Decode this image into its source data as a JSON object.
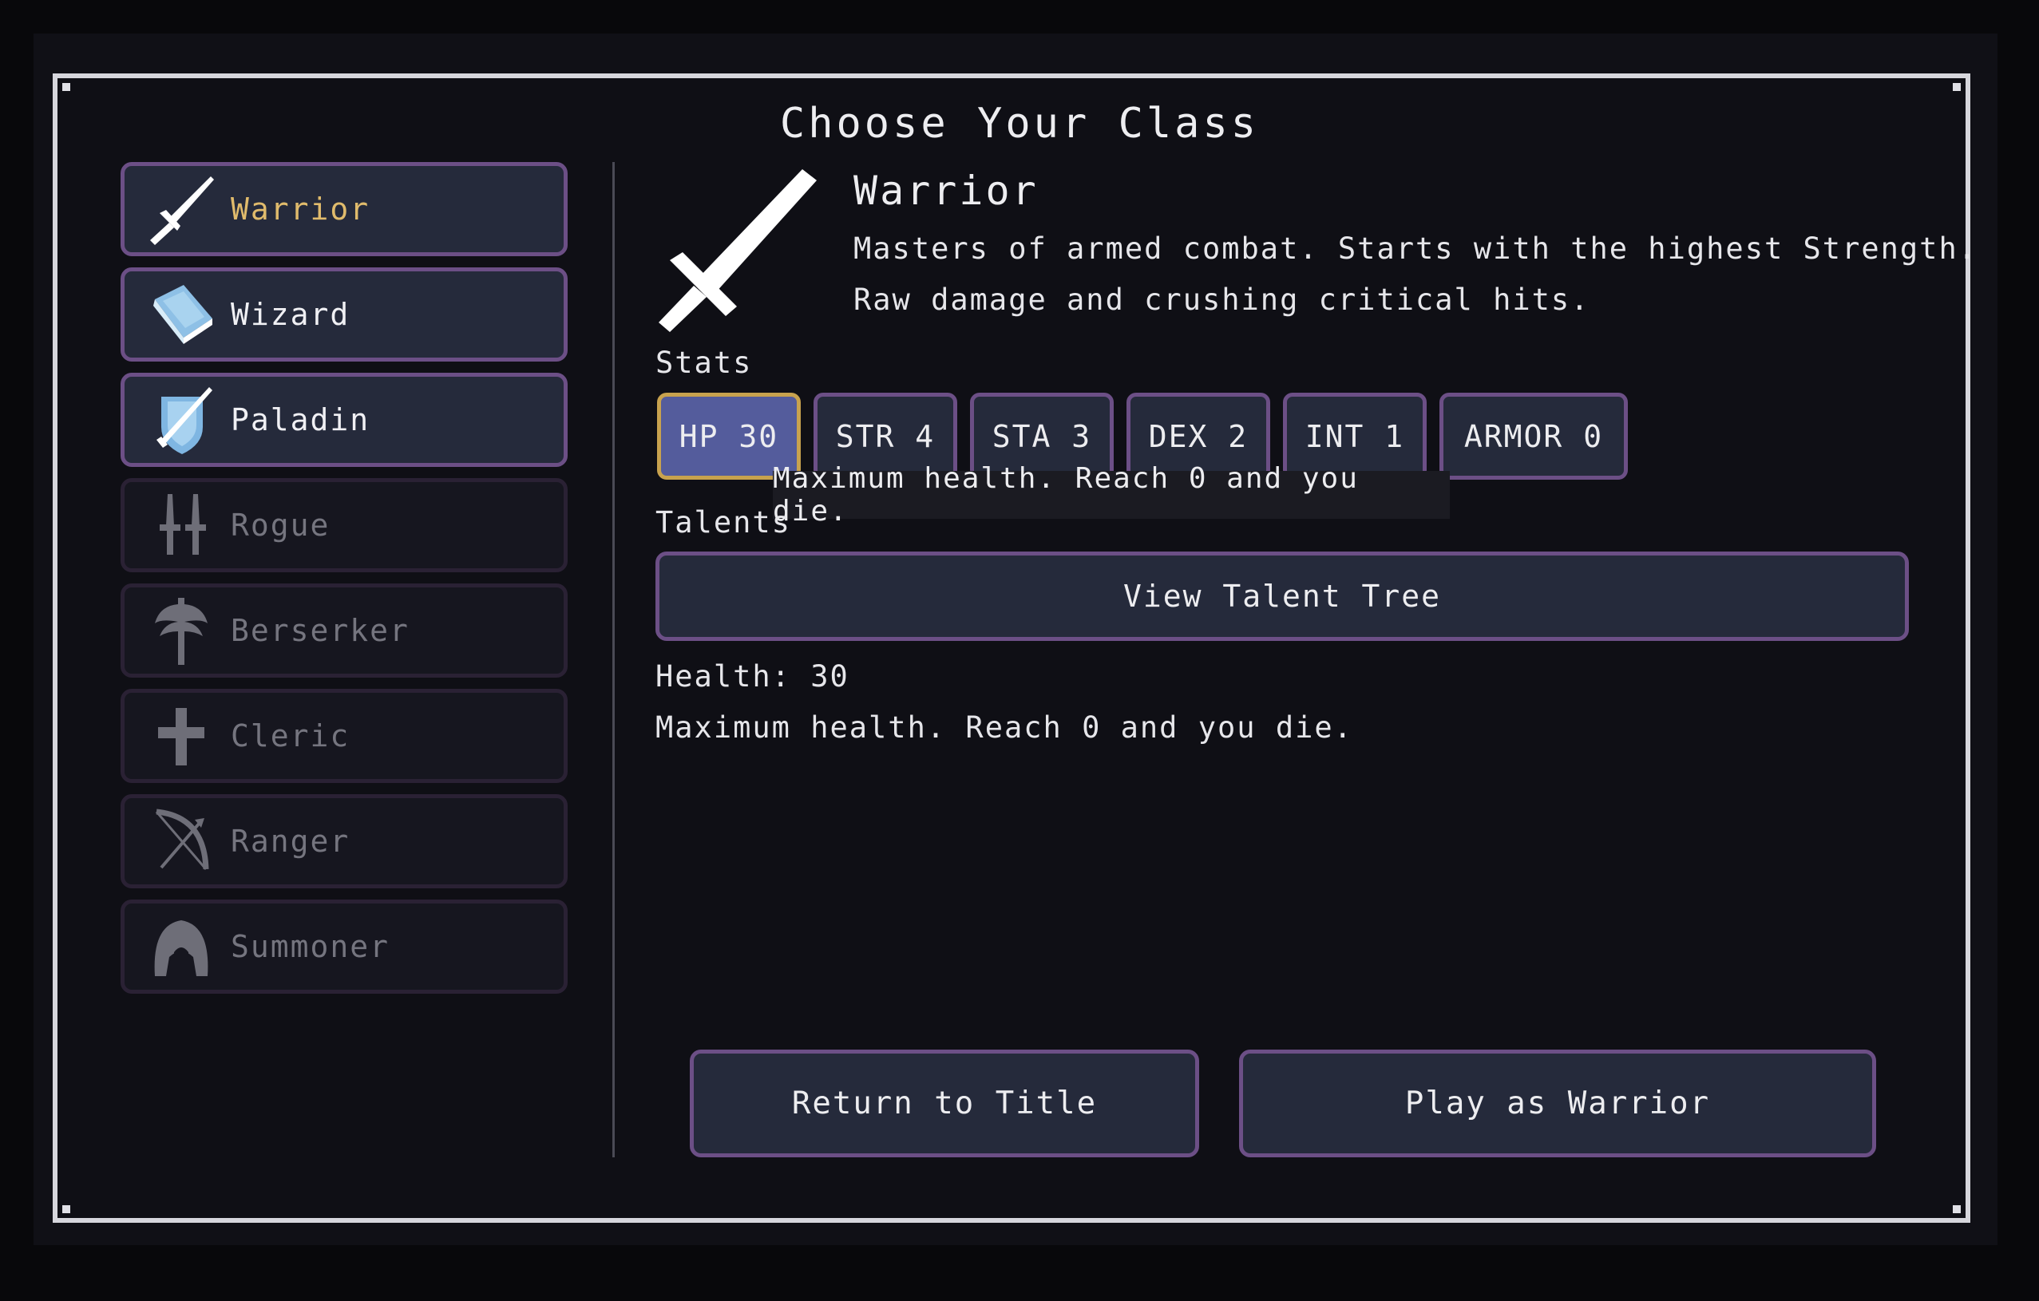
{
  "screen": {
    "title": "Choose Your Class"
  },
  "classes": [
    {
      "label": "Warrior",
      "icon": "sword-icon",
      "state": "selected"
    },
    {
      "label": "Wizard",
      "icon": "spellbook-icon",
      "state": "unlocked"
    },
    {
      "label": "Paladin",
      "icon": "shield-sword-icon",
      "state": "unlocked"
    },
    {
      "label": "Rogue",
      "icon": "daggers-icon",
      "state": "locked"
    },
    {
      "label": "Berserker",
      "icon": "battle-axe-icon",
      "state": "locked"
    },
    {
      "label": "Cleric",
      "icon": "cross-icon",
      "state": "locked"
    },
    {
      "label": "Ranger",
      "icon": "bow-icon",
      "state": "locked"
    },
    {
      "label": "Summoner",
      "icon": "hood-icon",
      "state": "locked"
    }
  ],
  "detail": {
    "name": "Warrior",
    "description_line1": "Masters of armed combat. Starts with the highest Strength.",
    "description_line2": "Raw damage and crushing critical hits.",
    "stats_heading": "Stats",
    "stats": [
      {
        "label": "HP 30",
        "active": true
      },
      {
        "label": "STR 4",
        "active": false
      },
      {
        "label": "STA 3",
        "active": false
      },
      {
        "label": "DEX 2",
        "active": false
      },
      {
        "label": "INT 1",
        "active": false
      },
      {
        "label": "ARMOR 0",
        "active": false
      }
    ],
    "tooltip": "Maximum health. Reach 0 and you die.",
    "talents_heading": "Talents",
    "talent_button": "View Talent Tree",
    "info_title": "Health: 30",
    "info_text": "Maximum health. Reach 0 and you die."
  },
  "actions": {
    "return_label": "Return to Title",
    "play_label": "Play as Warrior"
  },
  "colors": {
    "selected_text": "#e0bb6c",
    "button_border": "#6c4f86",
    "active_stat_fill": "#545c9c",
    "active_stat_border": "#c8a24e"
  }
}
